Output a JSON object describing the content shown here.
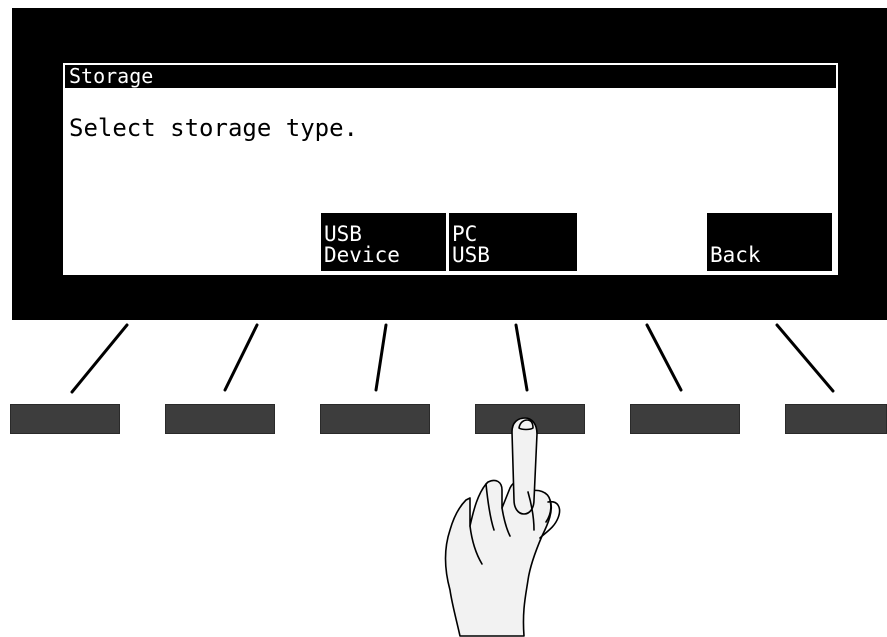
{
  "screen": {
    "title": "Storage",
    "message": "Select storage type."
  },
  "soft_keys": [
    {
      "label_lines": []
    },
    {
      "label_lines": []
    },
    {
      "label_lines": [
        "USB",
        "Device"
      ]
    },
    {
      "label_lines": [
        "PC",
        "USB"
      ]
    },
    {
      "label_lines": []
    },
    {
      "label_lines": [
        "",
        "Back"
      ]
    }
  ],
  "pressed_key_index": 3,
  "colors": {
    "bezel": "#000000",
    "screen": "#ffffff",
    "button": "#3d3d3d",
    "hand_fill": "#f2f2f2"
  },
  "icons": {
    "pointer": "pointing-hand-icon"
  }
}
